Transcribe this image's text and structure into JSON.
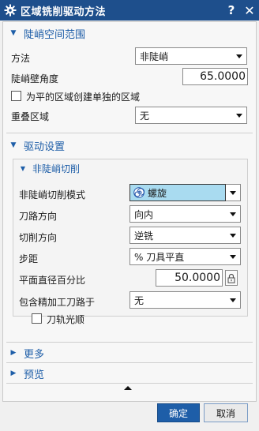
{
  "window": {
    "title": "区域铣削驱动方法",
    "help_glyph": "?",
    "close_glyph": "✕"
  },
  "steep_section": {
    "header": "陡峭空间范围",
    "method_label": "方法",
    "method_value": "非陡峭",
    "wall_angle_label": "陡峭壁角度",
    "wall_angle_value": "65.0000",
    "separate_regions_label": "为平的区域创建单独的区域",
    "overlap_label": "重叠区域",
    "overlap_value": "无"
  },
  "drive_section": {
    "header": "驱动设置",
    "sub_header": "非陡峭切削",
    "pattern_label": "非陡峭切削模式",
    "pattern_value": "螺旋",
    "pattern_icon": "spiral-icon",
    "toolpath_dir_label": "刀路方向",
    "toolpath_dir_value": "向内",
    "cut_dir_label": "切削方向",
    "cut_dir_value": "逆铣",
    "stepover_label": "步距",
    "stepover_value": "% 刀具平直",
    "flat_pct_label": "平面直径百分比",
    "flat_pct_value": "50.0000",
    "finish_label": "包含精加工刀路于",
    "finish_value": "无",
    "smooth_label": "刀轨光顺"
  },
  "collapsed": {
    "more": "更多",
    "preview": "预览"
  },
  "footer": {
    "ok": "确定",
    "cancel": "取消"
  },
  "colors": {
    "titlebar": "#1e4f8c",
    "accent": "#1e5ea8",
    "pattern_highlight": "#a9dbf0"
  }
}
